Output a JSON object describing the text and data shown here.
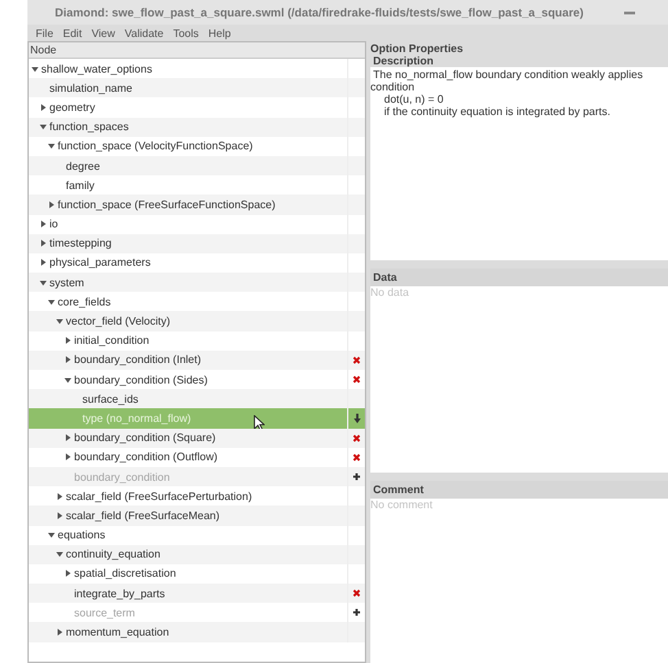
{
  "window": {
    "title": "Diamond: swe_flow_past_a_square.swml (/data/firedrake-fluids/tests/swe_flow_past_a_square)"
  },
  "menu": [
    "File",
    "Edit",
    "View",
    "Validate",
    "Tools",
    "Help"
  ],
  "tree": {
    "header": "Node",
    "nodes": [
      {
        "label": "shallow_water_options",
        "expanded": true,
        "children": [
          {
            "label": "simulation_name"
          },
          {
            "label": "geometry",
            "expanded": false
          },
          {
            "label": "function_spaces",
            "expanded": true,
            "children": [
              {
                "label": "function_space (VelocityFunctionSpace)",
                "expanded": true,
                "children": [
                  {
                    "label": "degree"
                  },
                  {
                    "label": "family"
                  }
                ]
              },
              {
                "label": "function_space (FreeSurfaceFunctionSpace)",
                "expanded": false
              }
            ]
          },
          {
            "label": "io",
            "expanded": false
          },
          {
            "label": "timestepping",
            "expanded": false
          },
          {
            "label": "physical_parameters",
            "expanded": false
          },
          {
            "label": "system",
            "expanded": true,
            "children": [
              {
                "label": "core_fields",
                "expanded": true,
                "children": [
                  {
                    "label": "vector_field (Velocity)",
                    "expanded": true,
                    "children": [
                      {
                        "label": "initial_condition",
                        "expanded": false
                      },
                      {
                        "label": "boundary_condition (Inlet)",
                        "expanded": false,
                        "removable": true
                      },
                      {
                        "label": "boundary_condition (Sides)",
                        "expanded": true,
                        "removable": true,
                        "children": [
                          {
                            "label": "surface_ids"
                          },
                          {
                            "label": "type (no_normal_flow)",
                            "selected": true,
                            "has_choices": true
                          }
                        ]
                      },
                      {
                        "label": "boundary_condition (Square)",
                        "expanded": false,
                        "removable": true
                      },
                      {
                        "label": "boundary_condition (Outflow)",
                        "expanded": false,
                        "removable": true
                      },
                      {
                        "label": "boundary_condition",
                        "inactive": true,
                        "addable": true
                      }
                    ]
                  },
                  {
                    "label": "scalar_field (FreeSurfacePerturbation)",
                    "expanded": false
                  },
                  {
                    "label": "scalar_field (FreeSurfaceMean)",
                    "expanded": false
                  }
                ]
              },
              {
                "label": "equations",
                "expanded": true,
                "children": [
                  {
                    "label": "continuity_equation",
                    "expanded": true,
                    "children": [
                      {
                        "label": "spatial_discretisation",
                        "expanded": false
                      },
                      {
                        "label": "integrate_by_parts",
                        "removable": true
                      },
                      {
                        "label": "source_term",
                        "inactive": true,
                        "addable": true
                      }
                    ]
                  },
                  {
                    "label": "momentum_equation",
                    "expanded": false
                  }
                ]
              }
            ]
          }
        ]
      }
    ]
  },
  "properties": {
    "title": "Option Properties",
    "description": {
      "header": "Description",
      "lines": [
        "The no_normal_flow boundary condition weakly applies",
        "condition",
        "dot(u, n) = 0",
        "if the continuity equation is integrated by parts."
      ]
    },
    "data": {
      "header": "Data",
      "placeholder": "No data"
    },
    "comment": {
      "header": "Comment",
      "placeholder": "No comment"
    }
  }
}
